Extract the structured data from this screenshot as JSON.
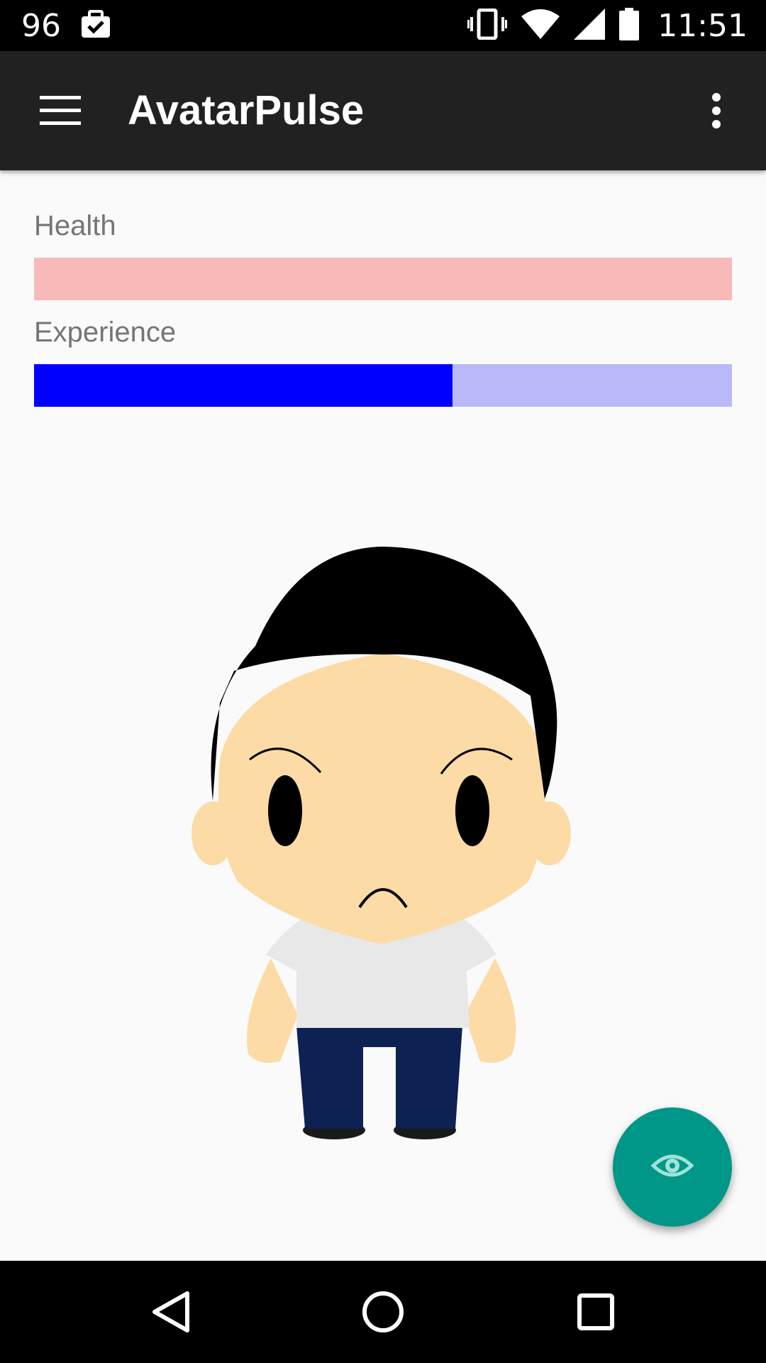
{
  "status_bar": {
    "notification_count": "96",
    "time": "11:51",
    "icons": [
      "briefcase-check-icon",
      "vibrate-icon",
      "wifi-icon",
      "cell-signal-icon",
      "battery-icon"
    ]
  },
  "app_bar": {
    "title": "AvatarPulse",
    "menu_icon": "hamburger-menu-icon",
    "overflow_icon": "more-vert-icon"
  },
  "stats": {
    "health": {
      "label": "Health",
      "value": 0,
      "track_color": "#f8b9b9",
      "fill_color": "#ff0000"
    },
    "experience": {
      "label": "Experience",
      "value": 0.6,
      "track_color": "#b9b9f8",
      "fill_color": "#0000ff"
    }
  },
  "avatar": {
    "skin_color": "#fddba6",
    "hair_color": "#000000",
    "shirt_color": "#e8e8e8",
    "pants_color": "#0d2152",
    "mood": "sad"
  },
  "fab": {
    "icon": "eye-icon",
    "color": "#009688"
  },
  "nav_bar": {
    "back_icon": "back-triangle-icon",
    "home_icon": "home-circle-icon",
    "recents_icon": "recents-square-icon"
  }
}
